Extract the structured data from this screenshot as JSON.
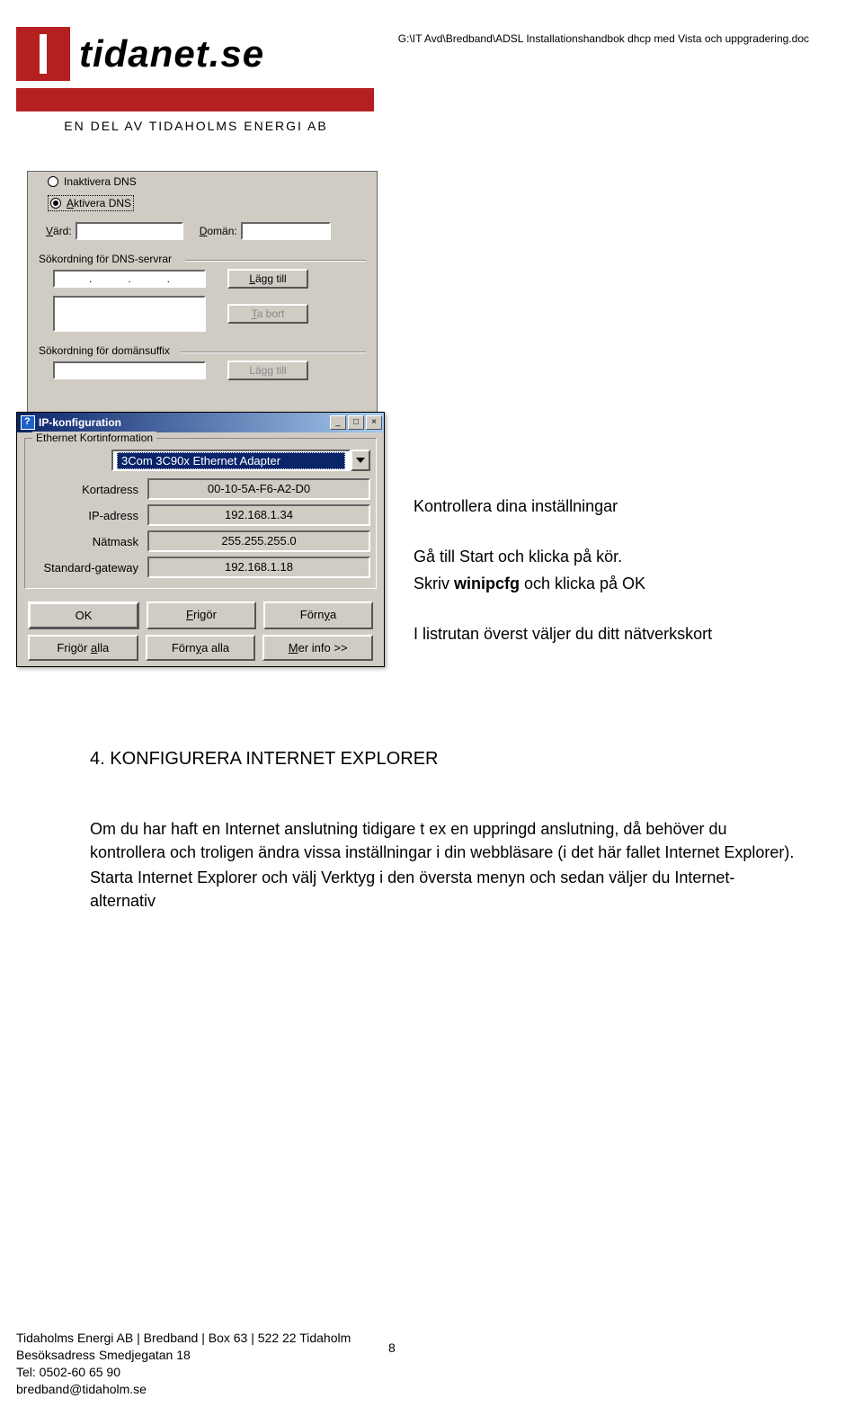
{
  "header_path": "G:\\IT Avd\\Bredband\\ADSL Installationshandbok dhcp med Vista och uppgradering.doc",
  "logo": {
    "brand": "tidanet.se",
    "tagline": "EN DEL AV TIDAHOLMS ENERGI AB"
  },
  "dns_dialog": {
    "radio1": "Inaktivera DNS",
    "radio2": "Aktivera DNS",
    "radio2_underline": "A",
    "vard_label": "Värd:",
    "vard_underline": "V",
    "doman_label": "Domän:",
    "doman_underline": "D",
    "sokordning_dns": "Sökordning för DNS-servrar",
    "lagg_till": "Lägg till",
    "ta_bort": "Ta bort",
    "sokordning_suffix": "Sökordning för domänsuffix"
  },
  "ip_dialog": {
    "title": "IP-konfiguration",
    "groupbox": "Ethernet Kortinformation",
    "adapter": "3Com 3C90x Ethernet Adapter",
    "rows": [
      {
        "label": "Kortadress",
        "value": "00-10-5A-F6-A2-D0"
      },
      {
        "label": "IP-adress",
        "value": "192.168.1.34"
      },
      {
        "label": "Nätmask",
        "value": "255.255.255.0"
      },
      {
        "label": "Standard-gateway",
        "value": "192.168.1.18"
      }
    ],
    "btns1": [
      "OK",
      "Frigör",
      "Förnya"
    ],
    "btns2": [
      "Frigör alla",
      "Förnya alla",
      "Mer info >>"
    ]
  },
  "body": {
    "p1_title": "Kontrollera dina inställningar",
    "p2": "Gå till Start och klicka på kör.",
    "p3a": "Skriv ",
    "p3b": "winipcfg",
    "p3c": " och klicka på OK",
    "p4": "I listrutan överst väljer du ditt nätverkskort",
    "heading": "4. KONFIGURERA INTERNET EXPLORER",
    "p5": "Om du har haft en Internet anslutning tidigare t ex en uppringd anslutning, då behöver du kontrollera och troligen ändra vissa inställningar i din webbläsare (i det här fallet Internet Explorer).",
    "p6": "Starta Internet Explorer och välj Verktyg i den översta menyn och sedan väljer du Internet-alternativ"
  },
  "footer": {
    "line1": "Tidaholms Energi AB | Bredband | Box 63 | 522 22 Tidaholm",
    "line2": "Besöksadress Smedjegatan 18",
    "line3": "Tel: 0502-60 65 90",
    "line4": "bredband@tidaholm.se",
    "page": "8"
  }
}
